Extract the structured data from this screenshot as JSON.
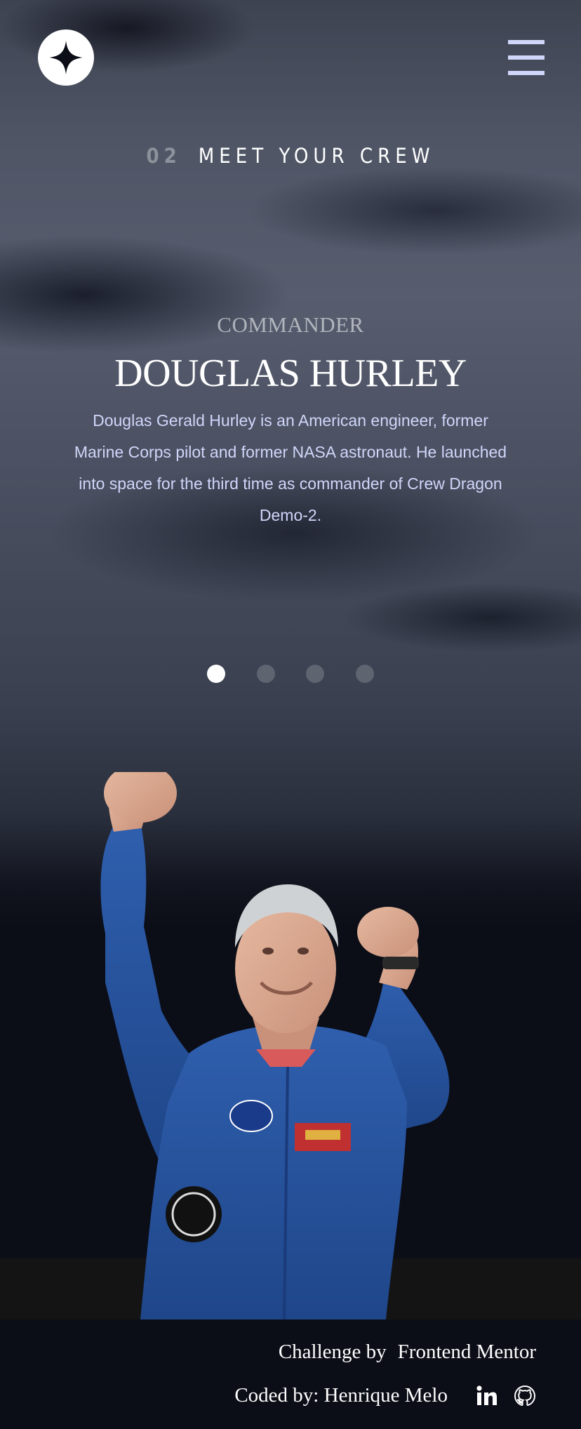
{
  "header": {
    "logo_icon": "star-logo-icon",
    "menu_icon": "hamburger-menu-icon"
  },
  "page_heading": {
    "number": "02",
    "title": "MEET YOUR CREW"
  },
  "crew_member": {
    "role": "COMMANDER",
    "name": "DOUGLAS HURLEY",
    "bio": "Douglas Gerald Hurley is an American engineer, former Marine Corps pilot and former NASA astronaut. He launched into space for the third time as commander of Crew Dragon Demo-2."
  },
  "pagination": {
    "count": 4,
    "active_index": 0
  },
  "footer": {
    "challenge_prefix": "Challenge by",
    "challenge_link": "Frontend Mentor",
    "coded_by_prefix": "Coded by:",
    "author": "Henrique Melo",
    "icons": [
      "linkedin-icon",
      "github-icon"
    ]
  },
  "colors": {
    "background": "#0b0d17",
    "accent": "#d0d6f9",
    "text": "#ffffff"
  }
}
